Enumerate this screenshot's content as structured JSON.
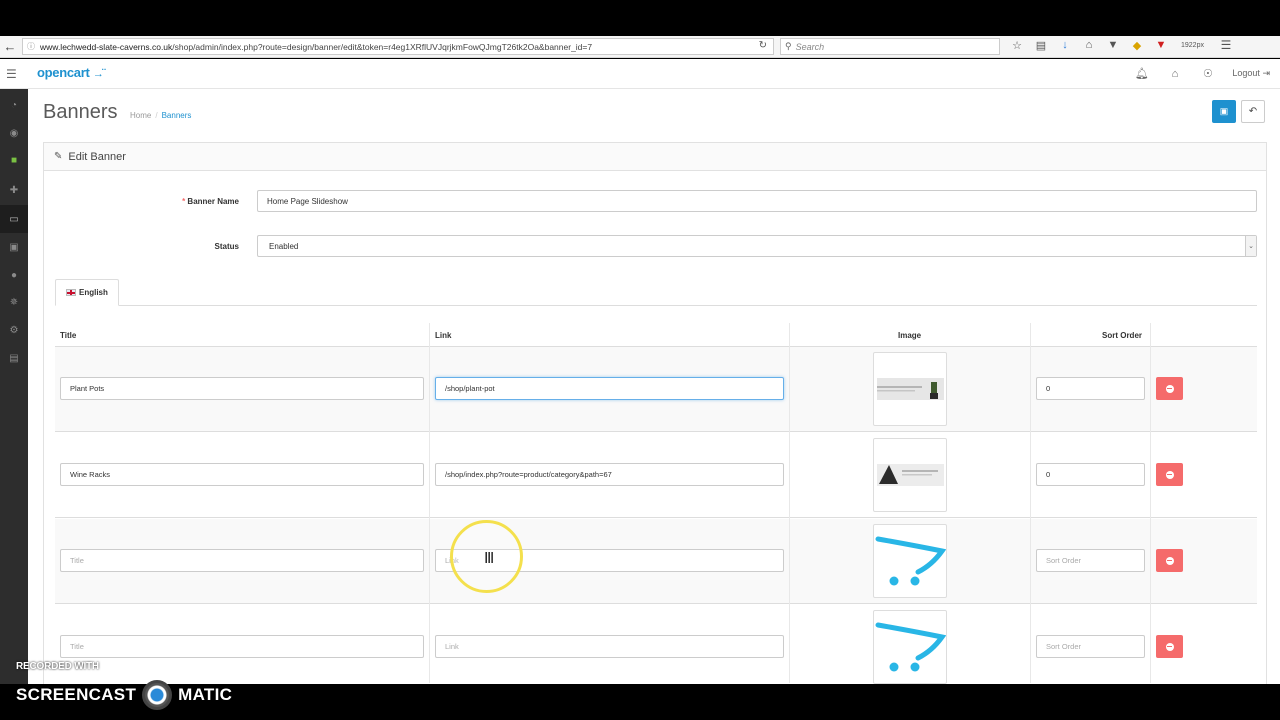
{
  "browser": {
    "url_prefix": "www.lechwedd-slate-caverns.co.uk",
    "url_path": "/shop/admin/index.php?route=design/banner/edit&token=r4eg1XRflUVJqrjkmFowQJmgT26tk2Oa&banner_id=7",
    "search_placeholder": "Search",
    "zoom_text": "1922px",
    "icons": [
      "back-icon",
      "reload-icon",
      "search-icon",
      "star-icon",
      "reading-list-icon",
      "download-icon",
      "home-icon",
      "pocket-icon",
      "extension-icon",
      "shield-icon",
      "menu-icon"
    ]
  },
  "header": {
    "logo_text": "opencart",
    "logout_label": "Logout",
    "icons": [
      "bell-icon",
      "home-icon",
      "globe-icon",
      "sign-out-icon"
    ]
  },
  "sidebar": {
    "items": [
      "dashboard-icon",
      "tag-icon",
      "shirt-icon",
      "puzzle-icon",
      "monitor-icon",
      "cart-icon",
      "user-icon",
      "share-icon",
      "gear-icon",
      "bar-chart-icon"
    ]
  },
  "page": {
    "title": "Banners",
    "breadcrumb": [
      "Home",
      "Banners"
    ],
    "panel_title": "Edit Banner"
  },
  "form": {
    "banner_name_label": "Banner Name",
    "banner_name_required": "*",
    "banner_name_value": "Home Page Slideshow",
    "status_label": "Status",
    "status_value": "Enabled",
    "language_tab": "English"
  },
  "table": {
    "headers": [
      "Title",
      "Link",
      "Image",
      "Sort Order"
    ],
    "rows": [
      {
        "title": "Plant Pots",
        "link": "/shop/plant-pot",
        "sort": "0",
        "image": "plant-pot-banner"
      },
      {
        "title": "Wine Racks",
        "link": "/shop/index.php?route=product/category&path=67",
        "sort": "0",
        "image": "wine-rack-banner"
      },
      {
        "title_placeholder": "Title",
        "link_placeholder": "Link",
        "sort_placeholder": "Sort Order",
        "image": "opencart-placeholder"
      },
      {
        "title_placeholder": "Title",
        "link_placeholder": "Link",
        "sort_placeholder": "Sort Order",
        "image": "opencart-placeholder"
      }
    ]
  },
  "watermark": {
    "line1": "RECORDED WITH",
    "line2a": "SCREENCAST",
    "line2b": "MATIC"
  },
  "colors": {
    "brand_blue": "#1e91cf",
    "danger": "#f56b6b",
    "sidebar_bg": "#2d2d2d",
    "active_green": "#7ac143",
    "cursor_ring": "#f4e04d"
  }
}
